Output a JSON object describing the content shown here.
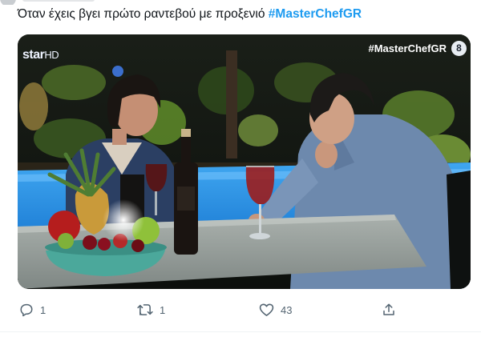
{
  "tweet": {
    "text": "Όταν έχεις βγει πρώτο ραντεβού με προξενιό",
    "hashtag": "#MasterChefGR"
  },
  "media": {
    "channel_logo": "star",
    "channel_logo_suffix": "HD",
    "overlay_hashtag": "#MasterChefGR",
    "rating_badge": "8"
  },
  "actions": {
    "replies": "1",
    "retweets": "1",
    "likes": "43"
  },
  "colors": {
    "hashtag_blue": "#1d9bf0",
    "text": "#0f1419",
    "icon_gray": "#536471"
  },
  "icons": [
    "reply-icon",
    "retweet-icon",
    "like-icon",
    "share-icon"
  ]
}
